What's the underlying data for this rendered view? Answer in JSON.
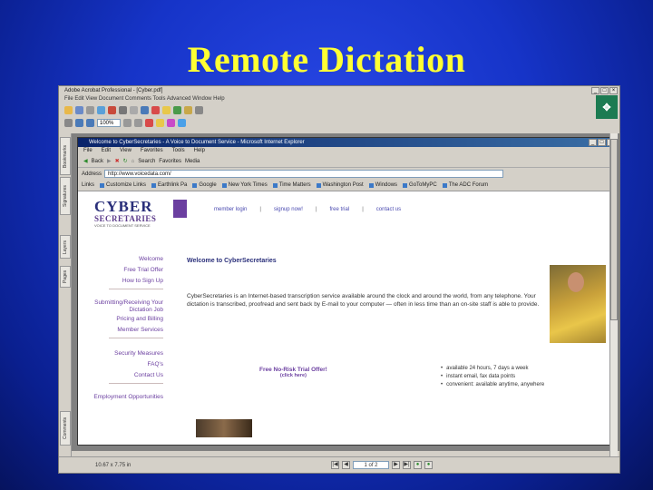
{
  "slide": {
    "title": "Remote Dictation"
  },
  "acrobat": {
    "window_title": "Adobe Acrobat Professional - [Cyber.pdf]",
    "menu": "File  Edit  View  Document  Comments  Tools  Advanced  Window  Help",
    "zoom": "100%",
    "nav_tabs": [
      "Bookmarks",
      "Signatures",
      "Layers",
      "Pages",
      "Comments"
    ],
    "status": {
      "page_size": "10.67 x 7.75 in",
      "page_of": "1 of 2"
    }
  },
  "ie": {
    "window_title": "Welcome to CyberSecretaries - A Voice to Document Service - Microsoft Internet Explorer",
    "menu": [
      "File",
      "Edit",
      "View",
      "Favorites",
      "Tools",
      "Help"
    ],
    "toolbar": {
      "back": "Back",
      "search": "Search",
      "favorites": "Favorites",
      "media": "Media"
    },
    "address_label": "Address",
    "address": "http://www.voicedata.com/",
    "links_label": "Links",
    "links": [
      "Customize Links",
      "Earthlink Pa",
      "Google",
      "New York Times",
      "Time Matters",
      "Washington Post",
      "Windows",
      "GoToMyPC",
      "The ADC Forum"
    ]
  },
  "webpage": {
    "logo": {
      "line1": "CYBER",
      "line2": "SECRETARIES",
      "tag": "VOICE TO DOCUMENT SERVICE"
    },
    "topnav": [
      "member login",
      "signup now!",
      "free trial",
      "contact us"
    ],
    "sidenav_group1": [
      "Welcome",
      "Free Trial Offer",
      "How to Sign Up"
    ],
    "sidenav_group2": [
      "Submitting/Receiving Your Dictation Job",
      "Pricing and Billing",
      "Member Services"
    ],
    "sidenav_group3": [
      "Security Measures",
      "FAQ's",
      "Contact Us"
    ],
    "sidenav_group4": [
      "Employment Opportunities"
    ],
    "welcome_heading": "Welcome to CyberSecretaries",
    "body": "CyberSecretaries is an Internet-based transcription service available around the clock and around the world, from any telephone. Your dictation is transcribed, proofread and sent back by E-mail to your computer — often in less time than an on-site staff is able to provide.",
    "offer": "Free No-Risk Trial Offer!",
    "offer_sub": "(click here)",
    "bullets": [
      "available 24 hours, 7 days a week",
      "instant email, fax data points",
      "convenient: available anytime, anywhere"
    ]
  }
}
